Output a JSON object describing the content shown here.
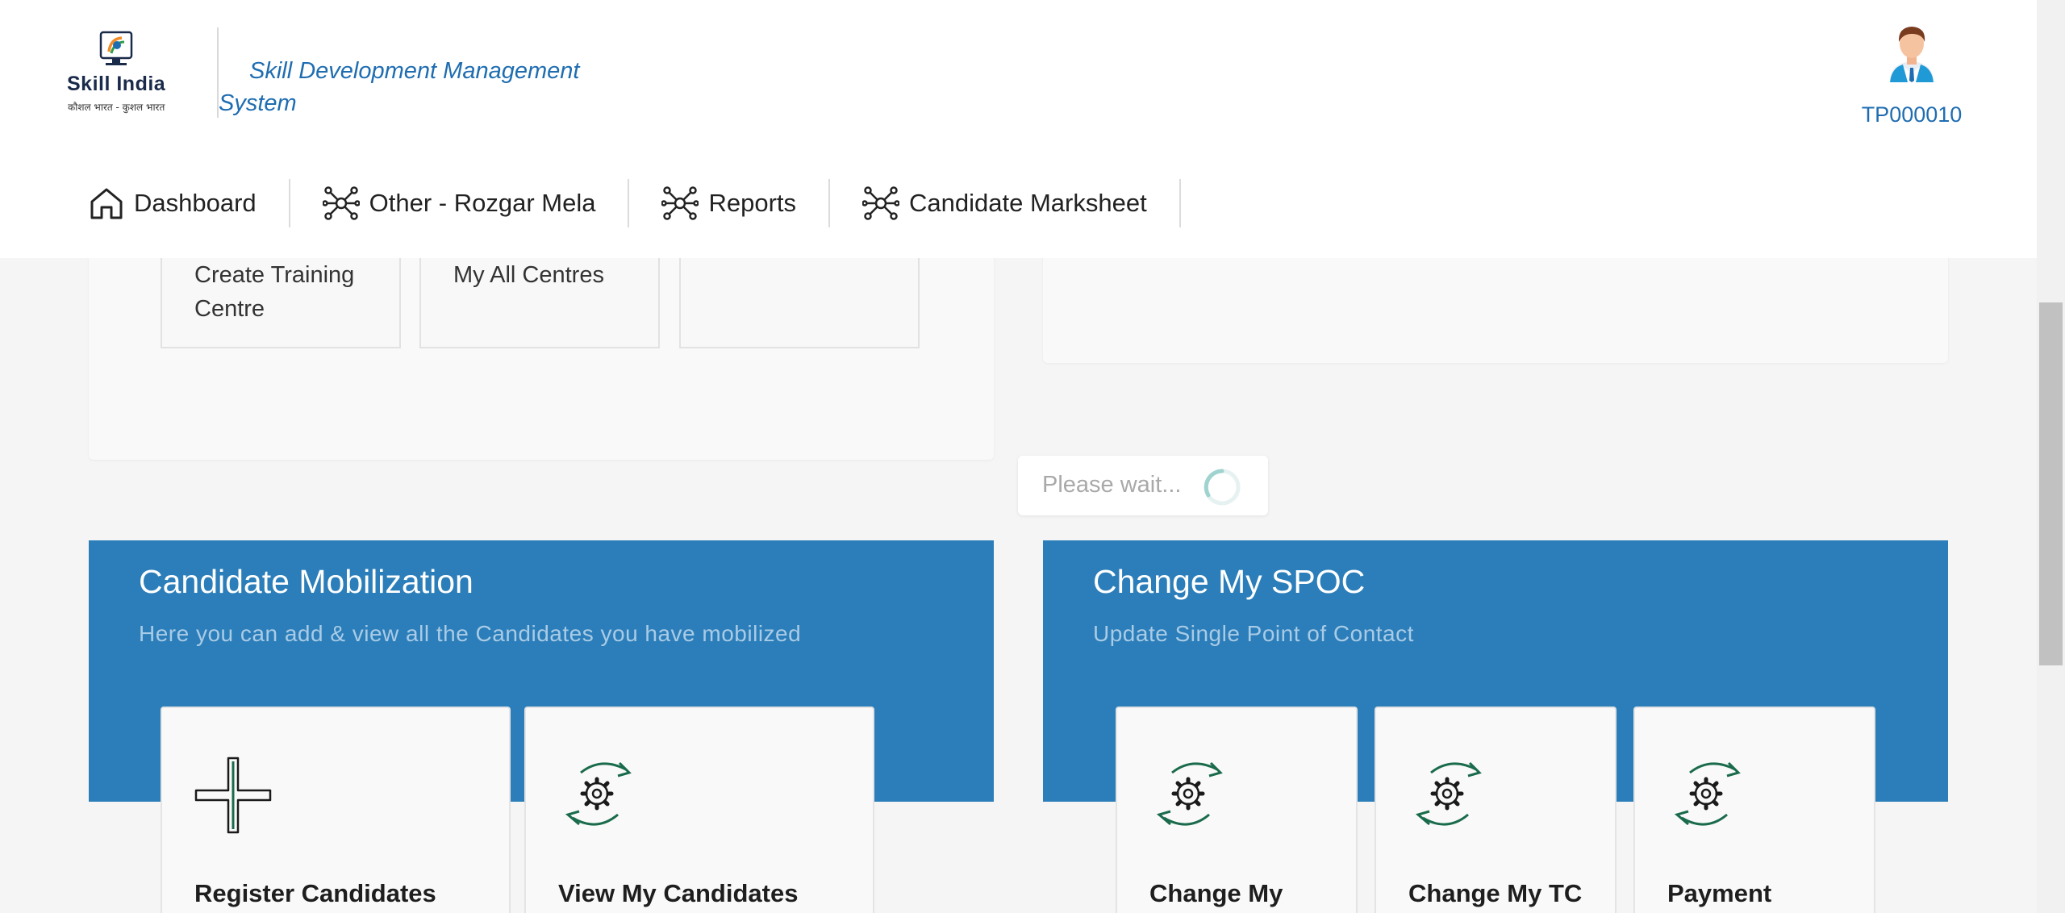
{
  "header": {
    "logo_brand": "Skill India",
    "logo_tagline": "कौशल भारत - कुशल भारत",
    "app_title": "Skill Development Management System",
    "user_id": "TP000010"
  },
  "nav": {
    "items": [
      {
        "label": "Dashboard",
        "icon": "home-icon"
      },
      {
        "label": "Other - Rozgar Mela",
        "icon": "network-icon"
      },
      {
        "label": "Reports",
        "icon": "network-icon"
      },
      {
        "label": "Candidate Marksheet",
        "icon": "network-icon"
      }
    ]
  },
  "training_centre": {
    "cards": [
      "Create Training Centre",
      "My All Centres",
      ""
    ]
  },
  "loader": {
    "text": "Please wait..."
  },
  "candidate_mobilization": {
    "title": "Candidate Mobilization",
    "subtitle": "Here you can add & view all the Candidates you have mobilized",
    "cards": [
      {
        "label": "Register Candidates",
        "icon": "plus-icon"
      },
      {
        "label": "View My Candidates",
        "icon": "gear-sync-icon"
      }
    ]
  },
  "change_spoc": {
    "title": "Change My SPOC",
    "subtitle": "Update Single Point of Contact",
    "cards": [
      {
        "label": "Change My",
        "icon": "gear-sync-icon"
      },
      {
        "label": "Change My TC",
        "icon": "gear-sync-icon"
      },
      {
        "label": "Payment",
        "icon": "gear-sync-icon"
      }
    ]
  },
  "colors": {
    "accent_blue": "#2b7eb9",
    "link_blue": "#1f6db1",
    "icon_green": "#1a6b4c"
  }
}
